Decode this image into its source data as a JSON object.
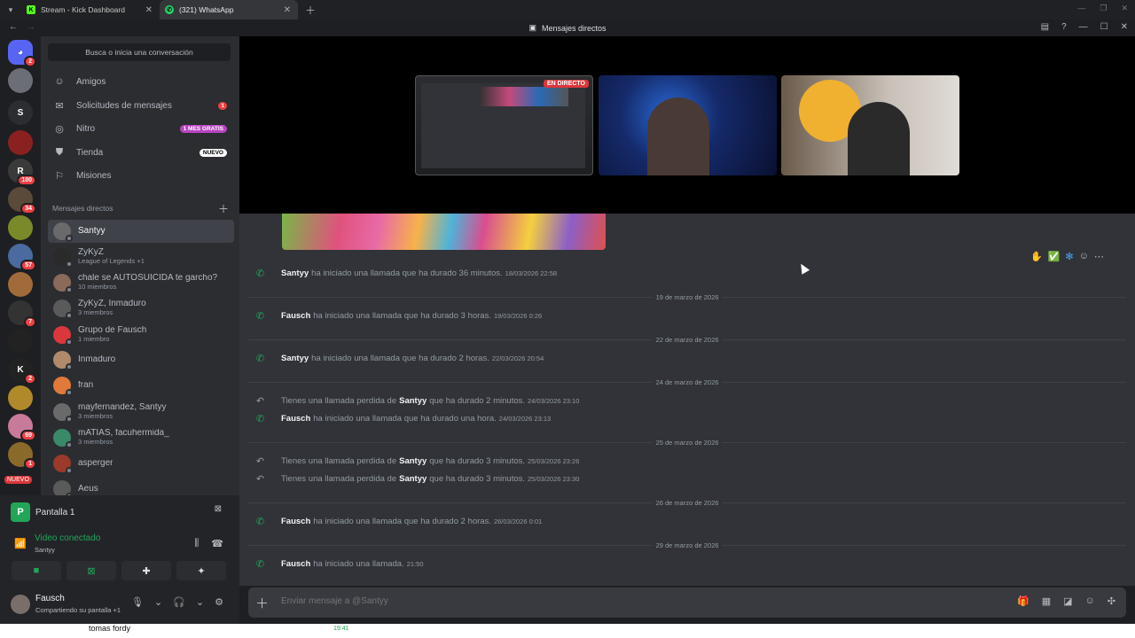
{
  "browser": {
    "tabs": [
      {
        "label": "Stream - Kick Dashboard",
        "icon": "kick-icon",
        "color": "#53fc18"
      },
      {
        "label": "(321) WhatsApp",
        "icon": "whatsapp-icon",
        "color": "#25d366"
      }
    ]
  },
  "window": {
    "title": "Mensajes directos"
  },
  "servers": [
    {
      "badge": "2",
      "color": "#5865f2",
      "label": "",
      "icon": "discord-icon"
    },
    {
      "badge": "",
      "color": "#6b6f75",
      "label": ""
    },
    {
      "badge": "",
      "color": "#2b2d31",
      "label": "S"
    },
    {
      "badge": "",
      "color": "#8a2020",
      "label": ""
    },
    {
      "badge": "100",
      "color": "#3a3a3a",
      "label": "R"
    },
    {
      "badge": "34",
      "color": "#5a4a3a",
      "label": ""
    },
    {
      "badge": "",
      "color": "#7a8a2a",
      "label": ""
    },
    {
      "badge": "57",
      "color": "#4a6aa0",
      "label": ""
    },
    {
      "badge": "",
      "color": "#a06a3a",
      "label": ""
    },
    {
      "badge": "7",
      "color": "#333",
      "label": ""
    },
    {
      "badge": "",
      "color": "#222",
      "label": ""
    },
    {
      "badge": "2",
      "color": "#222",
      "label": "K"
    },
    {
      "badge": "",
      "color": "#b08a2a",
      "label": ""
    },
    {
      "badge": "69",
      "color": "#c87a9a",
      "label": ""
    },
    {
      "badge": "1",
      "color": "#8a6a2a",
      "label": ""
    }
  ],
  "server_new_label": "NUEVO",
  "sidebar": {
    "search_placeholder": "Busca o inicia una conversación",
    "nav": [
      {
        "label": "Amigos",
        "icon": "friends-icon"
      },
      {
        "label": "Solicitudes de mensajes",
        "icon": "mail-icon",
        "badge": "1"
      },
      {
        "label": "Nitro",
        "icon": "nitro-icon",
        "pill": "1 MES GRATIS"
      },
      {
        "label": "Tienda",
        "icon": "shop-icon",
        "pill": "NUEVO"
      },
      {
        "label": "Misiones",
        "icon": "quests-icon"
      }
    ],
    "dm_header": "Mensajes directos",
    "dms": [
      {
        "name": "Santyy",
        "sub": "",
        "color": "#6a6a6a"
      },
      {
        "name": "ZyKyZ",
        "sub": "League of Legends +1",
        "color": "#2a2a2a"
      },
      {
        "name": "chale se AUTOSUICIDA te garcho?",
        "sub": "10 miembros",
        "color": "#8a6a5a"
      },
      {
        "name": "ZyKyZ, Inmaduro",
        "sub": "3 miembros",
        "color": "#5a5a5a"
      },
      {
        "name": "Grupo de Fausch",
        "sub": "1 miembro",
        "color": "#da373c"
      },
      {
        "name": "Inmaduro",
        "sub": "",
        "color": "#b08a6a"
      },
      {
        "name": "fran",
        "sub": "",
        "color": "#e07a3a"
      },
      {
        "name": "mayfernandez, Santyy",
        "sub": "3 miembros",
        "color": "#6a6a6a"
      },
      {
        "name": "mATIAS, facuhermida_",
        "sub": "3 miembros",
        "color": "#3a8a6a"
      },
      {
        "name": "asperger",
        "sub": "",
        "color": "#9a3a2a"
      },
      {
        "name": "Aeus",
        "sub": "",
        "color": "#5a5a5a"
      }
    ]
  },
  "voice": {
    "stream_title": "Pantalla 1",
    "status": "Video conectado",
    "channel": "Santyy"
  },
  "user": {
    "name": "Fausch",
    "status": "Compartiendo su pantalla +1"
  },
  "stage": {
    "live_label": "EN DIRECTO"
  },
  "messages": [
    {
      "type": "call",
      "user": "Santyy",
      "text": "ha iniciado una llamada que ha durado 36 minutos.",
      "ts": "18/03/2026 22:58"
    },
    {
      "type": "date",
      "label": "19 de marzo de 2026"
    },
    {
      "type": "call",
      "user": "Fausch",
      "text": "ha iniciado una llamada que ha durado 3 horas.",
      "ts": "19/03/2026 0:26"
    },
    {
      "type": "date",
      "label": "22 de marzo de 2026"
    },
    {
      "type": "call",
      "user": "Santyy",
      "text": "ha iniciado una llamada que ha durado 2 horas.",
      "ts": "22/03/2026 20:54"
    },
    {
      "type": "date",
      "label": "24 de marzo de 2026"
    },
    {
      "type": "missed",
      "prefix": "Tienes una llamada perdida de",
      "user": "Santyy",
      "text": "que ha durado 2 minutos.",
      "ts": "24/03/2026 23:10"
    },
    {
      "type": "call",
      "user": "Fausch",
      "text": "ha iniciado una llamada que ha durado una hora.",
      "ts": "24/03/2026 23:13"
    },
    {
      "type": "date",
      "label": "25 de marzo de 2026"
    },
    {
      "type": "missed",
      "prefix": "Tienes una llamada perdida de",
      "user": "Santyy",
      "text": "que ha durado 3 minutos.",
      "ts": "25/03/2026 23:26"
    },
    {
      "type": "missed",
      "prefix": "Tienes una llamada perdida de",
      "user": "Santyy",
      "text": "que ha durado 3 minutos.",
      "ts": "25/03/2026 23:30"
    },
    {
      "type": "date",
      "label": "26 de marzo de 2026"
    },
    {
      "type": "call",
      "user": "Fausch",
      "text": "ha iniciado una llamada que ha durado 2 horas.",
      "ts": "26/03/2026 0:01"
    },
    {
      "type": "date",
      "label": "29 de marzo de 2026"
    },
    {
      "type": "call",
      "user": "Fausch",
      "text": "ha iniciado una llamada.",
      "ts": "21:50"
    }
  ],
  "composer": {
    "placeholder": "Enviar mensaje a @Santyy"
  },
  "bottom": {
    "name": "tomas fordy",
    "time": "19:41"
  }
}
